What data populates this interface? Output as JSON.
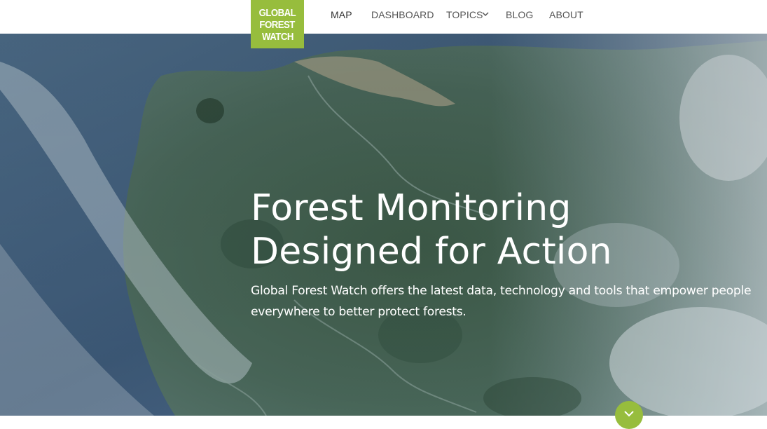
{
  "logo": {
    "line1": "GLOBAL",
    "line2": "FOREST",
    "line3": "WATCH",
    "color": "#97bd3d"
  },
  "nav": {
    "items": [
      {
        "label": "MAP"
      },
      {
        "label": "DASHBOARD"
      },
      {
        "label": "TOPICS"
      },
      {
        "label": "BLOG"
      },
      {
        "label": "ABOUT"
      }
    ],
    "active": "MAP"
  },
  "hero": {
    "title_line1": "Forest Monitoring",
    "title_line2": "Designed for Action",
    "subtitle": "Global Forest Watch offers the latest data, technology and tools that empower people everywhere to better protect forests."
  },
  "icons": {
    "topics_dropdown": "chevron-down-icon",
    "scroll_down": "chevron-down-icon"
  },
  "colors": {
    "accent": "#97bd3d",
    "nav_text": "#555555"
  }
}
